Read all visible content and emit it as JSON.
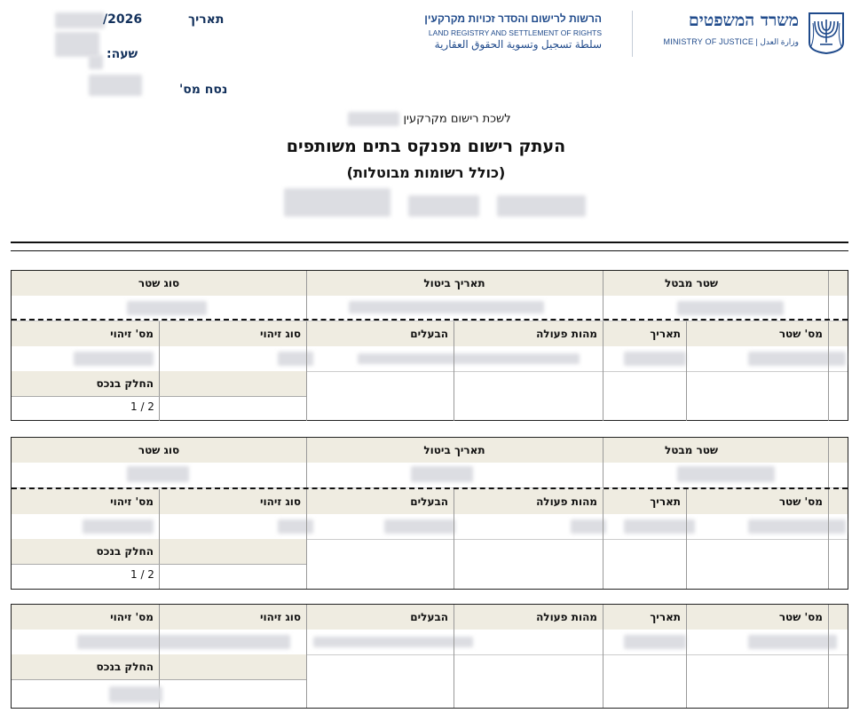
{
  "header": {
    "date_label": "תאריך",
    "date_value": "/2026",
    "time_label": "שעה:",
    "version_label": "נסח מס'",
    "ministry_he": "משרד המשפטים",
    "ministry_en": "MINISTRY OF JUSTICE",
    "ministry_ar": "وزارة العدل",
    "agency_he": "הרשות לרישום והסדר זכויות מקרקעין",
    "agency_en": "LAND REGISTRY AND SETTLEMENT OF RIGHTS",
    "agency_ar": "سلطة تسجيل وتسوية الحقوق العقارية",
    "emblem_icon": "menorah-emblem-icon",
    "brand_color": "#1f4a8b"
  },
  "document": {
    "office_line": "לשכת רישום מקרקעין",
    "title": "העתק רישום מפנקס בתים משותפים",
    "subtitle": "(כולל רשומות מבוטלות)"
  },
  "columns": {
    "cancelled_deed": "שטר מבטל",
    "cancel_date": "תאריך ביטול",
    "deed_type": "סוג שטר",
    "deed_no": "מס' שטר",
    "date": "תאריך",
    "action": "מהות פעולה",
    "owners": "הבעלים",
    "id_type": "סוג זיהוי",
    "id_no": "מס' זיהוי",
    "share": "החלק בנכס"
  },
  "blocks": [
    {
      "share_value": "1 / 2"
    },
    {
      "share_value": "1 / 2"
    },
    {
      "share_value": ""
    }
  ]
}
